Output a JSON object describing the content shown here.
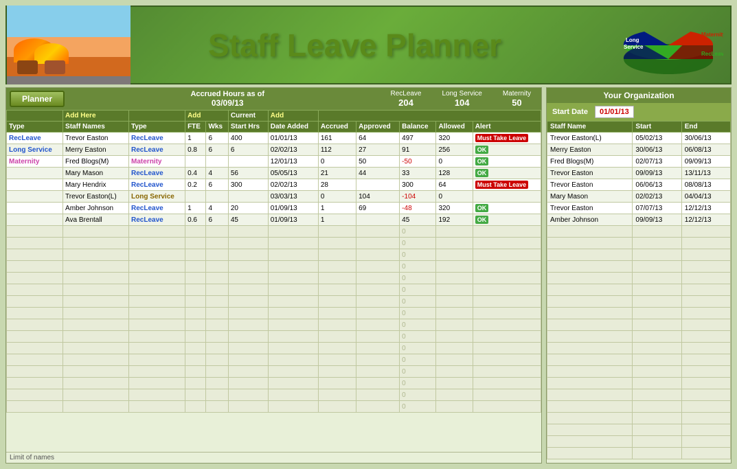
{
  "header": {
    "title": "Staff Leave Planner",
    "accrued_label": "Accrued Hours as of",
    "accrued_date": "03/09/13",
    "summaries": [
      {
        "label": "RecLeave",
        "value": "204"
      },
      {
        "label": "Long Service",
        "value": "104"
      },
      {
        "label": "Maternity",
        "value": "50"
      }
    ]
  },
  "planner_button": "Planner",
  "add_headers": {
    "add_here": "Add Here",
    "type": "Type",
    "fte": "Add FTE",
    "wks": "Add Wks",
    "current_start": "Current Start Hrs",
    "add_date": "Add Date Added"
  },
  "col_headers": {
    "type": "Type",
    "staff_name": "Staff Names",
    "leave_type": "Type",
    "fte": "FTE",
    "wks": "Wks",
    "start": "Start Hrs",
    "date_added": "Date Added",
    "accrued": "Accrued",
    "approved": "Approved",
    "balance": "Balance",
    "allowed": "Allowed",
    "alert": "Alert"
  },
  "rows": [
    {
      "type": "RecLeave",
      "staff": "Trevor Easton",
      "leave": "RecLeave",
      "fte": "1",
      "wks": "6",
      "start": "400",
      "date": "01/01/13",
      "accrued": "161",
      "approved": "64",
      "balance": "497",
      "allowed": "320",
      "alert": "Must Take Leave",
      "alert_type": "must",
      "rowtype": "recleave"
    },
    {
      "type": "Long Service",
      "staff": "Merry Easton",
      "leave": "RecLeave",
      "fte": "0.8",
      "wks": "6",
      "start": "6",
      "date": "02/02/13",
      "accrued": "112",
      "approved": "27",
      "balance": "91",
      "allowed": "256",
      "alert": "OK",
      "alert_type": "ok",
      "rowtype": "recleave"
    },
    {
      "type": "Maternity",
      "staff": "Fred Blogs(M)",
      "leave": "Maternity",
      "fte": "",
      "wks": "",
      "start": "",
      "date": "12/01/13",
      "accrued": "0",
      "approved": "50",
      "balance": "-50",
      "allowed": "0",
      "alert": "OK",
      "alert_type": "ok",
      "rowtype": "maternity"
    },
    {
      "type": "",
      "staff": "Mary Mason",
      "leave": "RecLeave",
      "fte": "0.4",
      "wks": "4",
      "start": "56",
      "date": "05/05/13",
      "accrued": "21",
      "approved": "44",
      "balance": "33",
      "allowed": "128",
      "alert": "OK",
      "alert_type": "ok",
      "rowtype": "recleave"
    },
    {
      "type": "",
      "staff": "Mary Hendrix",
      "leave": "RecLeave",
      "fte": "0.2",
      "wks": "6",
      "start": "300",
      "date": "02/02/13",
      "accrued": "28",
      "approved": "",
      "balance": "300",
      "allowed": "64",
      "alert": "Must Take Leave",
      "alert_type": "must",
      "rowtype": "recleave"
    },
    {
      "type": "",
      "staff": "Trevor Easton(L)",
      "leave": "Long Service",
      "fte": "",
      "wks": "",
      "start": "",
      "date": "03/03/13",
      "accrued": "0",
      "approved": "104",
      "balance": "-104",
      "allowed": "0",
      "alert": "",
      "alert_type": "",
      "rowtype": "long"
    },
    {
      "type": "",
      "staff": "Amber Johnson",
      "leave": "RecLeave",
      "fte": "1",
      "wks": "4",
      "start": "20",
      "date": "01/09/13",
      "accrued": "1",
      "approved": "69",
      "balance": "-48",
      "allowed": "320",
      "alert": "OK",
      "alert_type": "ok",
      "rowtype": "recleave"
    },
    {
      "type": "",
      "staff": "Ava Brentall",
      "leave": "RecLeave",
      "fte": "0.6",
      "wks": "6",
      "start": "45",
      "date": "01/09/13",
      "accrued": "1",
      "approved": "",
      "balance": "45",
      "allowed": "192",
      "alert": "OK",
      "alert_type": "ok",
      "rowtype": "recleave"
    }
  ],
  "empty_rows_count": 16,
  "limit_note": "Limit of names",
  "right_panel": {
    "title": "Your Organization",
    "start_date_label": "Start Date",
    "start_date": "01/01/13",
    "col_staff": "Staff Name",
    "col_start": "Start",
    "col_end": "End",
    "org_rows": [
      {
        "staff": "Trevor Easton(L)",
        "start": "05/02/13",
        "end": "30/06/13"
      },
      {
        "staff": "Merry Easton",
        "start": "30/06/13",
        "end": "06/08/13"
      },
      {
        "staff": "Fred Blogs(M)",
        "start": "02/07/13",
        "end": "09/09/13"
      },
      {
        "staff": "Trevor Easton",
        "start": "09/09/13",
        "end": "13/11/13"
      },
      {
        "staff": "Trevor Easton",
        "start": "06/06/13",
        "end": "08/08/13"
      },
      {
        "staff": "Mary Mason",
        "start": "02/02/13",
        "end": "04/04/13"
      },
      {
        "staff": "Trevor Easton",
        "start": "07/07/13",
        "end": "12/12/13"
      },
      {
        "staff": "Amber Johnson",
        "start": "09/09/13",
        "end": "12/12/13"
      }
    ]
  },
  "chart": {
    "segments": [
      {
        "label": "Maternity",
        "color": "#cc0000",
        "percent": 18
      },
      {
        "label": "Long\nService",
        "color": "#001a80",
        "percent": 32
      },
      {
        "label": "RecLeave",
        "color": "#228822",
        "percent": 50
      }
    ]
  }
}
